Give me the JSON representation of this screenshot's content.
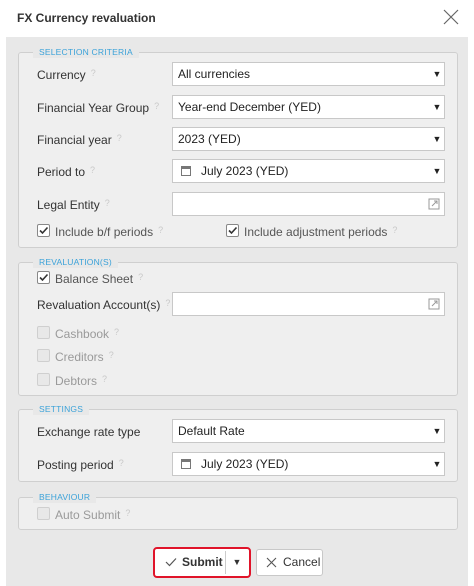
{
  "dialog": {
    "title": "FX Currency revaluation"
  },
  "icons": {
    "close": "close-icon",
    "help": "?",
    "calendar": "calendar-icon",
    "popout": "popout-icon",
    "checkmark": "checkmark-icon",
    "dropdown_arrow": "▼"
  },
  "selection_criteria": {
    "legend": "SELECTION CRITERIA",
    "currency": {
      "label": "Currency",
      "value": "All currencies"
    },
    "fy_group": {
      "label": "Financial Year Group",
      "value": "Year-end December (YED)"
    },
    "fin_year": {
      "label": "Financial year",
      "value": "2023 (YED)"
    },
    "period_to": {
      "label": "Period to",
      "value": "July 2023 (YED)"
    },
    "legal_entity": {
      "label": "Legal Entity",
      "value": ""
    },
    "include_bf": {
      "label": "Include b/f periods",
      "checked": true
    },
    "include_adj": {
      "label": "Include adjustment periods",
      "checked": true
    }
  },
  "revaluations": {
    "legend": "REVALUATION(S)",
    "balance_sheet": {
      "label": "Balance Sheet",
      "checked": true
    },
    "accounts": {
      "label": "Revaluation Account(s)",
      "value": ""
    },
    "cashbook": {
      "label": "Cashbook",
      "checked": false
    },
    "creditors": {
      "label": "Creditors",
      "checked": false
    },
    "debtors": {
      "label": "Debtors",
      "checked": false
    }
  },
  "settings": {
    "legend": "SETTINGS",
    "rate_type": {
      "label": "Exchange rate type",
      "value": "Default Rate"
    },
    "posting_period": {
      "label": "Posting period",
      "value": "July 2023 (YED)"
    }
  },
  "behaviour": {
    "legend": "BEHAVIOUR",
    "auto_submit": {
      "label": "Auto Submit",
      "checked": false
    }
  },
  "footer": {
    "submit_label": "Submit",
    "cancel_label": "Cancel"
  },
  "colors": {
    "accent": "#3ba2d9",
    "highlight_border": "#e0142a",
    "panel_bg": "#e8e8e8"
  }
}
